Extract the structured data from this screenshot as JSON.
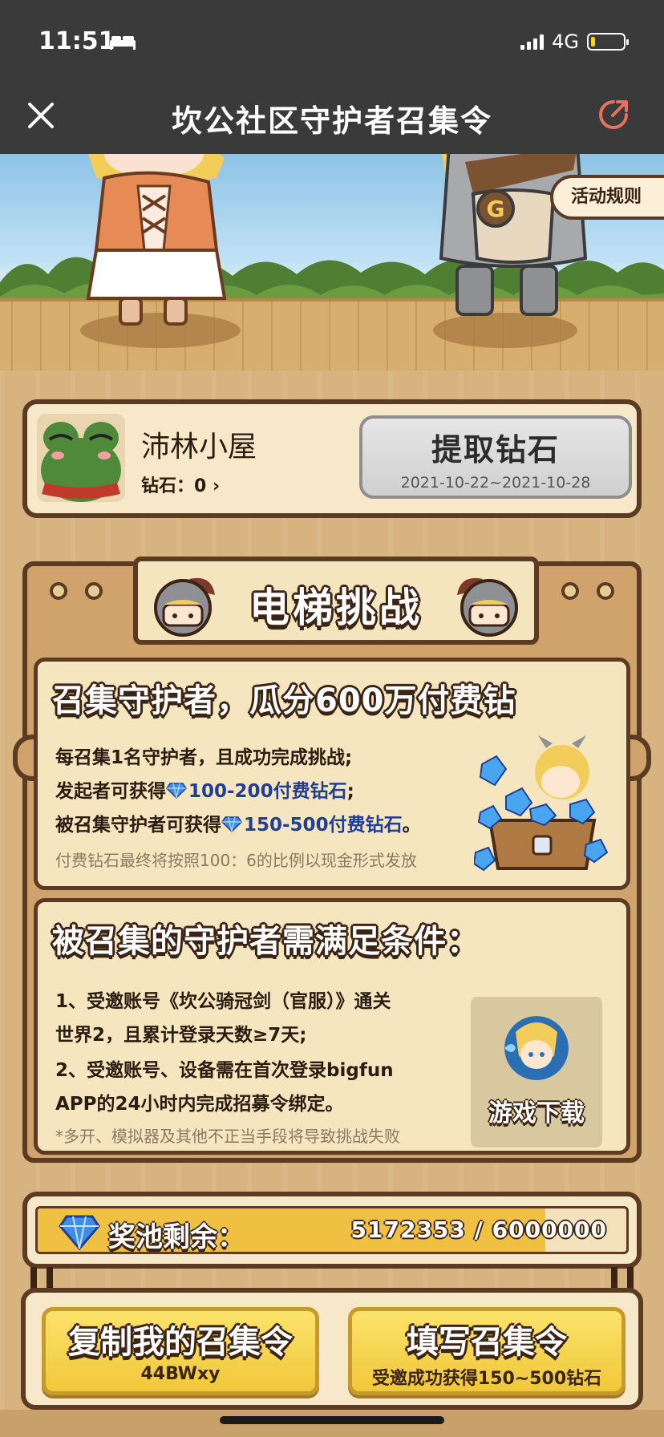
{
  "status_bar": {
    "time": "11:51",
    "network": "4G"
  },
  "header": {
    "title": "坎公社区守护者召集令"
  },
  "scene": {
    "rules_label": "活动规则"
  },
  "user": {
    "name": "沛林小屋",
    "diamond_label": "钻石：0 ",
    "extract_title": "提取钻石",
    "extract_date": "2021-10-22~2021-10-28"
  },
  "challenge": {
    "banner_title": "电梯挑战",
    "panel1": {
      "heading": "召集守护者，瓜分600万付费钻",
      "line1": "每召集1名守护者，且成功完成挑战;",
      "line2_prefix": "发起者可获得",
      "line2_value": "100-200付费钻石",
      "line2_suffix": ";",
      "line3_prefix": "被召集守护者可获得",
      "line3_value": "150-500付费钻石",
      "line3_suffix": "。",
      "note": "付费钻石最终将按照100：6的比例以现金形式发放"
    },
    "panel2": {
      "heading": "被召集的守护者需满足条件：",
      "line1": "1、受邀账号《坎公骑冠剑（官服）》通关",
      "line2": "世界2，且累计登录天数≥7天;",
      "line3": "2、受邀账号、设备需在首次登录bigfun",
      "line4": "APP的24小时内完成招募令绑定。",
      "note": "*多开、模拟器及其他不正当手段将导致挑战失败",
      "download_label": "游戏下载"
    }
  },
  "pool": {
    "label": "奖池剩余：",
    "value": "5172353 / 6000000",
    "remaining": 5172353,
    "total": 6000000
  },
  "actions": {
    "copy_title": "复制我的召集令",
    "copy_code": "44BWxy",
    "fill_title": "填写召集令",
    "fill_sub": "受邀成功获得150~500钻石"
  },
  "colors": {
    "accent": "#f0c043",
    "frame": "#5b3b22",
    "highlight": "#1f3e95"
  }
}
